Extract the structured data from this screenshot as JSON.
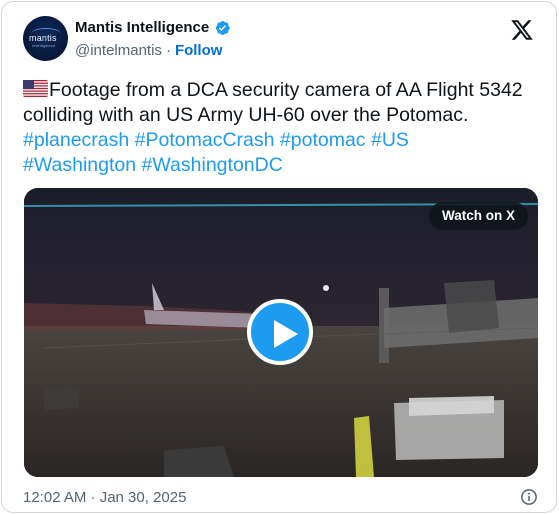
{
  "author": {
    "name": "Mantis Intelligence",
    "handle": "@intelmantis",
    "separator": "·",
    "follow_label": "Follow",
    "avatar_text": "mantis",
    "avatar_subtext": "intelligence"
  },
  "tweet": {
    "flag_icon": "us-flag-icon",
    "text": "Footage from a DCA security camera of AA Flight 5342 colliding with an US Army UH-60 over the Potomac.",
    "hashtags": [
      "#planecrash",
      "#PotomacCrash",
      "#potomac",
      "#US",
      "#Washington",
      "#WashingtonDC"
    ]
  },
  "media": {
    "watch_label": "Watch on X",
    "play_icon": "play-icon"
  },
  "footer": {
    "timestamp": "12:02 AM · Jan 30, 2025",
    "info_icon": "info-icon"
  },
  "colors": {
    "accent": "#1d9bf0",
    "follow": "#006fd6",
    "muted": "#536471",
    "text": "#0f1419",
    "border": "#cfd9de"
  }
}
